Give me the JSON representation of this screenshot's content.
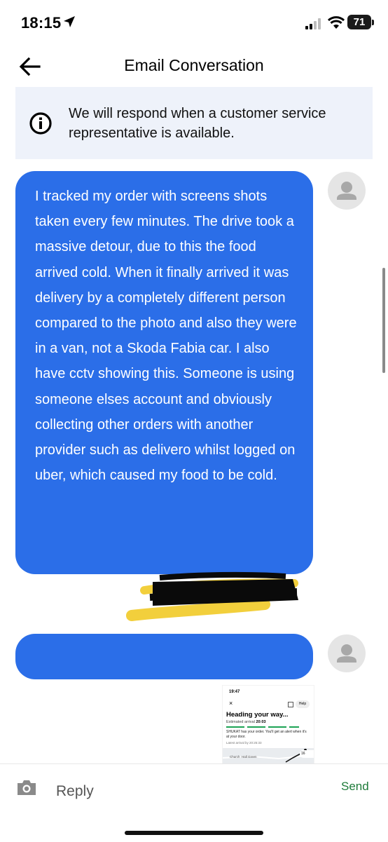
{
  "status_bar": {
    "time": "18:15",
    "battery": "71"
  },
  "header": {
    "title": "Email Conversation"
  },
  "banner": {
    "text": "We will respond when a customer service representative is available."
  },
  "messages": [
    {
      "text": "I tracked my order with screens shots taken every few minutes. The drive took a massive detour, due to this the food arrived cold. When it finally arrived it was delivery by a completely different person compared to the photo and also they were in a van, not a Skoda Fabia car. I also have cctv showing this. Someone is using someone elses account and obviously collecting other orders with another provider such as delivero whilst logged on uber, which caused my food to be cold."
    },
    {
      "text": ""
    }
  ],
  "attachment": {
    "time": "19:47",
    "close": "×",
    "help": "Help",
    "heading": "Heading your way...",
    "eta_label": "Estimated arrival",
    "eta_value": "20:03",
    "body": "SHUKAT has your order. You'll get an alert when it's at your door.",
    "latest": "Latest arrival by 20:25:33",
    "map_label": "Church",
    "map_label2": "Hall Green",
    "map_pill": "16"
  },
  "reply_bar": {
    "placeholder": "Reply",
    "send_label": "Send"
  },
  "colors": {
    "bubble": "#2b6ee8",
    "banner": "#eef2fa",
    "send": "#1e7b3a"
  }
}
